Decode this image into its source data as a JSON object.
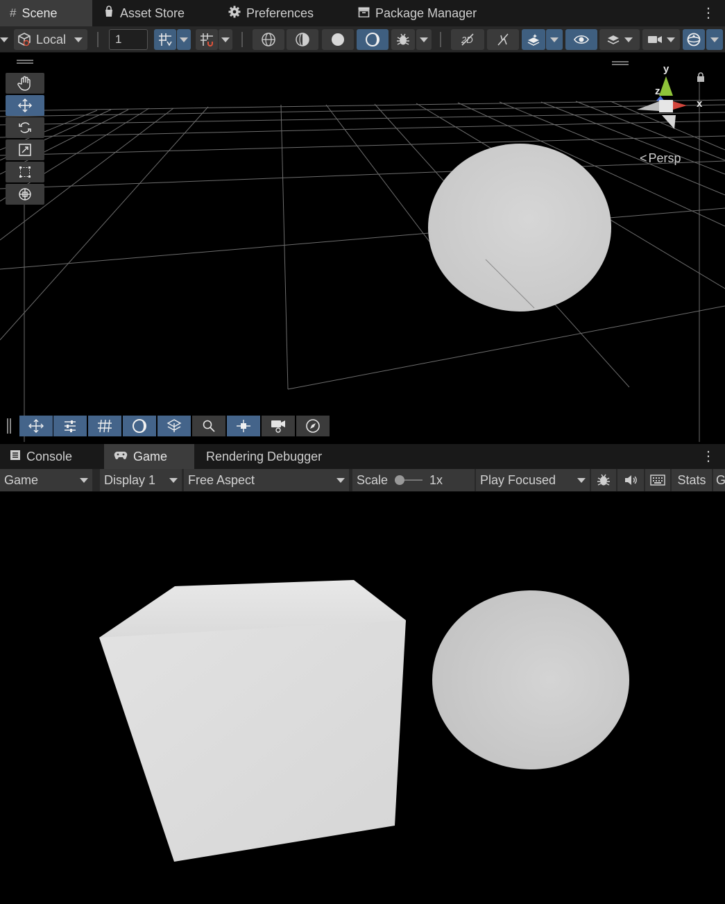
{
  "top_tabs": [
    {
      "label": "Scene",
      "icon": "hash-icon"
    },
    {
      "label": "Asset Store",
      "icon": "bag-icon"
    },
    {
      "label": "Preferences",
      "icon": "gear-icon"
    },
    {
      "label": "Package Manager",
      "icon": "package-icon"
    }
  ],
  "scene_toolbar": {
    "pivot_rotation": "Local",
    "snap_increment": "1"
  },
  "scene_view": {
    "projection_label": "Persp",
    "gizmo_axes": {
      "y": "y",
      "z": "z",
      "x": "x"
    }
  },
  "bottom_tabs": [
    {
      "label": "Console",
      "icon": "console-icon"
    },
    {
      "label": "Game",
      "icon": "gamepad-icon"
    },
    {
      "label": "Rendering Debugger",
      "icon": ""
    }
  ],
  "game_toolbar": {
    "view_mode": "Game",
    "display": "Display 1",
    "aspect": "Free Aspect",
    "scale_label": "Scale",
    "scale_value": "1x",
    "play_mode": "Play Focused",
    "stats": "Stats",
    "gizmos_cut": "G"
  },
  "colors": {
    "tab_bg": "#191919",
    "active_tab": "#3c3c3c",
    "toolbar": "#282828",
    "accent_blue": "#44648a"
  }
}
